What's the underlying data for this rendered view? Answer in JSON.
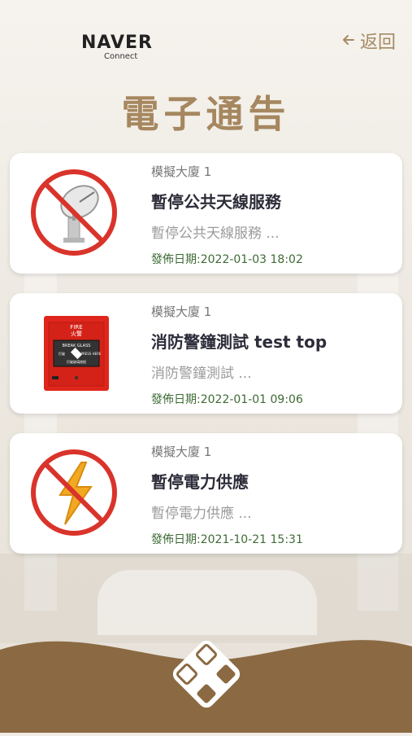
{
  "header": {
    "logo_main": "NAVER",
    "logo_sub": "Connect",
    "back_label": "返回",
    "page_title": "電子通告"
  },
  "notices": [
    {
      "building": "模擬大廈 1",
      "title": "暫停公共天線服務",
      "summary": "暫停公共天線服務 ...",
      "date": "發佈日期:2022-01-03 18:02",
      "icon": "no-antenna-icon"
    },
    {
      "building": "模擬大廈 1",
      "title": "消防警鐘測試 test top",
      "summary": "消防警鐘測試 ...",
      "date": "發佈日期:2022-01-01 09:06",
      "icon": "fire-alarm-icon"
    },
    {
      "building": "模擬大廈 1",
      "title": "暫停電力供應",
      "summary": "暫停電力供應 ...",
      "date": "發佈日期:2021-10-21 15:31",
      "icon": "no-electricity-icon"
    }
  ],
  "fire_alarm_text": {
    "top": "FIRE",
    "sub": "火警",
    "panel": "BREAK GLASS",
    "press_left": "打破",
    "press_right": "PRESS HERE",
    "bottom": "打破玻璃按鈕"
  },
  "colors": {
    "accent": "#a6875f",
    "date_green": "#3e6b35",
    "bottom_bar": "#8b6a43",
    "prohibit_red": "#d9342b"
  }
}
